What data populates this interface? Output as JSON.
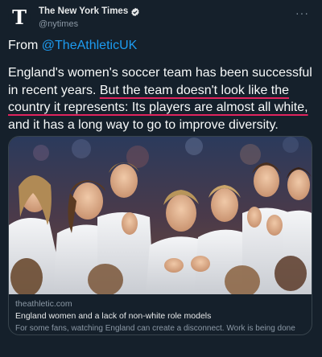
{
  "account": {
    "display_name": "The New York Times",
    "handle": "@nytimes",
    "verified_icon": "verified-badge-icon",
    "logo_glyph": "T",
    "more_label": "···"
  },
  "tweet": {
    "from_prefix": "From ",
    "from_link": "@TheAthleticUK",
    "text_part1": "England's women's soccer team has been successful in recent years. ",
    "text_underlined": "But the team doesn't look like the country it represents: Its players are almost all white,",
    "text_part2": " and it has a long way to go to improve diversity."
  },
  "card": {
    "image_alt": "England women's team players in white kits applauding",
    "domain": "theathletic.com",
    "title": "England women and a lack of non-white role models",
    "description": "For some fans, watching England can create a disconnect. Work is being done by to aid diversity but there remains much to accomplish"
  },
  "colors": {
    "background": "#15202b",
    "link": "#1d9bf0",
    "underline": "#e0245e",
    "muted": "#8b98a5"
  }
}
